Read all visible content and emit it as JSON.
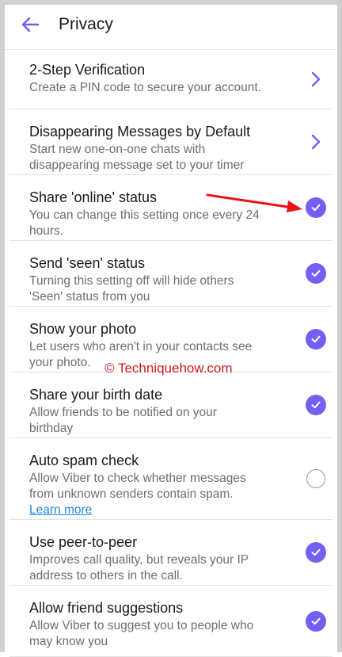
{
  "header": {
    "title": "Privacy",
    "back_icon": "arrow-left-icon"
  },
  "accent": "#7360f2",
  "watermark": "© Techniquehow.com",
  "settings": [
    {
      "title": "2-Step Verification",
      "desc": [
        "Create a PIN code to secure your account."
      ],
      "control": "chevron"
    },
    {
      "title": "Disappearing Messages by Default",
      "desc": [
        "Start new one-on-one chats with",
        "disappearing message set to your timer"
      ],
      "control": "chevron"
    },
    {
      "title": "Share 'online' status",
      "desc": [
        "You can change this setting once every 24",
        "hours."
      ],
      "control": "checked"
    },
    {
      "title": "Send 'seen' status",
      "desc": [
        "Turning this setting off will hide others",
        "'Seen' status from you"
      ],
      "control": "checked"
    },
    {
      "title": "Show your photo",
      "desc": [
        "Let users who aren't in your contacts see",
        "your photo."
      ],
      "control": "checked"
    },
    {
      "title": "Share your birth date",
      "desc": [
        "Allow friends to be notified on your",
        "birthday"
      ],
      "control": "checked"
    },
    {
      "title": "Auto spam check",
      "desc": [
        "Allow Viber to check whether messages",
        "from unknown senders contain spam."
      ],
      "link": "Learn more",
      "control": "unchecked"
    },
    {
      "title": "Use peer-to-peer",
      "desc": [
        "Improves call quality, but reveals your IP",
        "address to others in the call."
      ],
      "control": "checked"
    },
    {
      "title": "Allow friend suggestions",
      "desc": [
        "Allow Viber to suggest you to people who",
        "may know you"
      ],
      "control": "checked"
    }
  ]
}
